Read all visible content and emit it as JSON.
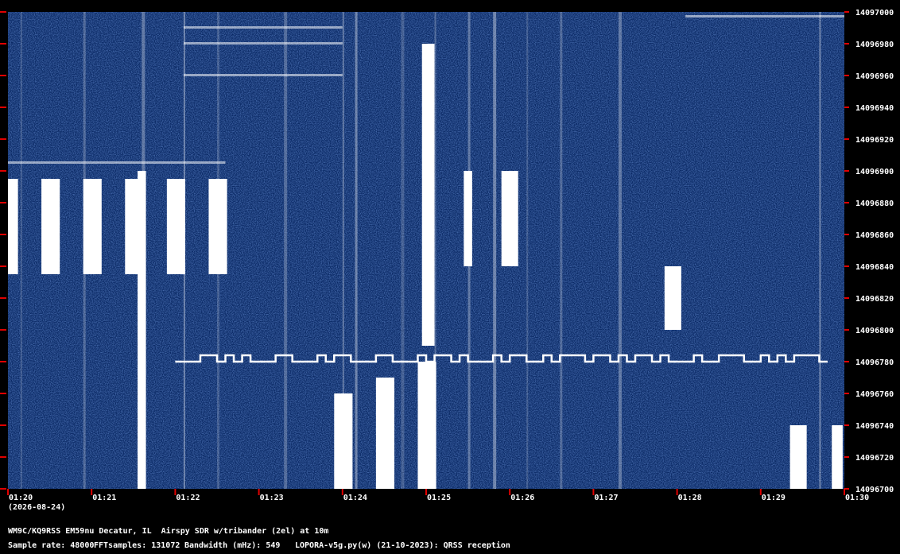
{
  "chart_data": {
    "type": "heatmap",
    "x_ticks": [
      "01:20",
      "01:21",
      "01:22",
      "01:23",
      "01:24",
      "01:25",
      "01:26",
      "01:27",
      "01:28",
      "01:29",
      "01:30"
    ],
    "date": "(2026-08-24)",
    "y_ticks": [
      14097000,
      14096980,
      14096960,
      14096940,
      14096920,
      14096900,
      14096880,
      14096860,
      14096840,
      14096820,
      14096800,
      14096780,
      14096760,
      14096740,
      14096720,
      14096700
    ],
    "ylim": [
      14096700,
      14097000
    ],
    "xlim_minutes": [
      0,
      10
    ],
    "trace_freq_hz": 14096780,
    "trace_start_min": 2.0,
    "trace_end_min": 9.8,
    "background_color": "#0b2a66",
    "signal_color": "#ffffff"
  },
  "footer": {
    "station": "WM9C/KQ9RSS EM59nu Decatur, IL  Airspy SDR w/tribander (2el) at 10m",
    "sample_rate": "Sample rate: 48000",
    "fft_samples": "FFTsamples: 131072",
    "bandwidth": "Bandwidth (mHz): 549",
    "software": "LOPORA-v5g.py(w) (21-10-2023): QRSS reception"
  }
}
